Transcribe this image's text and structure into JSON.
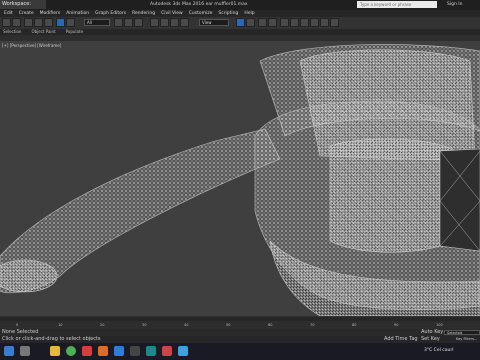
{
  "window": {
    "workspace": "Workspace: Default",
    "title": "Autodesk 3ds Max 2016    ear muffler01.max",
    "search_placeholder": "Type a keyword or phrase",
    "signin": "Sign In"
  },
  "menu": [
    "Edit",
    "Create",
    "Modifiers",
    "Animation",
    "Graph Editors",
    "Rendering",
    "Civil View",
    "Customize",
    "Scripting",
    "Help"
  ],
  "toolbar": {
    "selection_filter": "All",
    "view_dropdown": "View"
  },
  "ribbon": [
    "Selection",
    "Object Paint",
    "Populate"
  ],
  "viewport": {
    "label": "[+] [Perspective] [Wireframe]"
  },
  "timeline": {
    "ticks": [
      "0",
      "10",
      "20",
      "30",
      "40",
      "50",
      "60",
      "70",
      "80",
      "90",
      "100"
    ]
  },
  "status": {
    "selection": "None Selected",
    "prompt": "Click or click-and-drag to select objects",
    "add_time_tag": "Add Time Tag",
    "auto_key": "Auto Key",
    "set_key": "Set Key",
    "key_filter": "Selected",
    "key_filters_btn": "Key Filters..."
  },
  "taskbar": {
    "weather": "3°C  Cel caurl"
  },
  "colors": {
    "viewport_bg": "#3f3f3f",
    "wire": "#c9c9c9",
    "accent": "#2a68b5"
  }
}
